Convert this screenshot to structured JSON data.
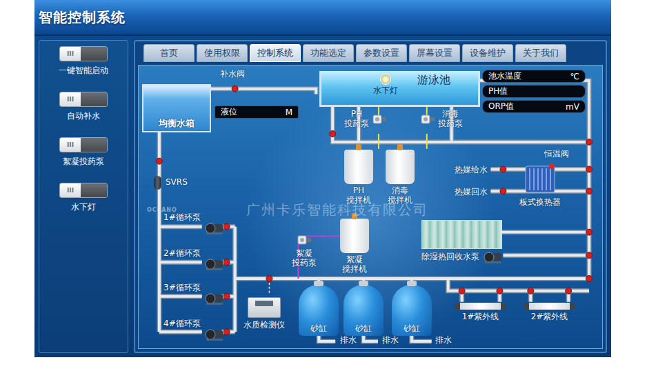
{
  "window": {
    "title": "智能控制系统"
  },
  "sidebar": {
    "switches": [
      {
        "label": "一键智能启动",
        "toggle": "III",
        "on": false
      },
      {
        "label": "自动补水",
        "toggle": "III",
        "on": false
      },
      {
        "label": "絮凝投药泵",
        "toggle": "III",
        "on": false
      },
      {
        "label": "水下灯",
        "toggle": "III",
        "on": false
      }
    ]
  },
  "tabs": [
    {
      "label": "首页",
      "selected": false
    },
    {
      "label": "使用权限",
      "selected": false
    },
    {
      "label": "控制系统",
      "selected": true
    },
    {
      "label": "功能选定",
      "selected": false
    },
    {
      "label": "参数设置",
      "selected": false
    },
    {
      "label": "屏幕设置",
      "selected": false
    },
    {
      "label": "设备维护",
      "selected": false
    },
    {
      "label": "关于我们",
      "selected": false
    }
  ],
  "readings": [
    {
      "label": "池水温度",
      "unit": "℃"
    },
    {
      "label": "PH值",
      "unit": ""
    },
    {
      "label": "ORP值",
      "unit": "mV"
    }
  ],
  "level": {
    "label": "液位",
    "unit": "M"
  },
  "watermark": {
    "logo": "OCEANO",
    "company": "广州卡乐智能科技有限公司"
  },
  "nodes": [
    {
      "kind": "label",
      "lines": [
        "补水阀"
      ]
    },
    {
      "kind": "tank",
      "lines": [
        "均衡水箱"
      ]
    },
    {
      "kind": "pool",
      "lines": [
        "游泳池"
      ]
    },
    {
      "kind": "light",
      "lines": [
        "水下灯"
      ]
    },
    {
      "kind": "svrs",
      "lines": [
        "SVRS"
      ]
    },
    {
      "kind": "pump",
      "lines": [
        "1#循环泵"
      ]
    },
    {
      "kind": "pump",
      "lines": [
        "2#循环泵"
      ]
    },
    {
      "kind": "pump",
      "lines": [
        "3#循环泵"
      ]
    },
    {
      "kind": "pump",
      "lines": [
        "4#循环泵"
      ]
    },
    {
      "kind": "doser",
      "lines": [
        "PH",
        "投药泵"
      ]
    },
    {
      "kind": "doser",
      "lines": [
        "消毒",
        "投药泵"
      ]
    },
    {
      "kind": "mixer",
      "lines": [
        "PH",
        "搅拌机"
      ]
    },
    {
      "kind": "mixer",
      "lines": [
        "消毒",
        "搅拌机"
      ]
    },
    {
      "kind": "doser",
      "lines": [
        "絮凝",
        "投药泵"
      ]
    },
    {
      "kind": "mixer",
      "lines": [
        "絮凝",
        "搅拌机"
      ]
    },
    {
      "kind": "label",
      "lines": [
        "热媒给水"
      ]
    },
    {
      "kind": "label",
      "lines": [
        "热媒回水"
      ]
    },
    {
      "kind": "label",
      "lines": [
        "恒温阀"
      ]
    },
    {
      "kind": "exchanger",
      "lines": [
        "板式换热器"
      ]
    },
    {
      "kind": "dehumidifier",
      "lines": [
        "除湿热回收水泵"
      ]
    },
    {
      "kind": "detector",
      "lines": [
        "水质检测仪"
      ]
    },
    {
      "kind": "sand",
      "lines": [
        "砂缸"
      ]
    },
    {
      "kind": "sand",
      "lines": [
        "砂缸"
      ]
    },
    {
      "kind": "sand",
      "lines": [
        "砂缸"
      ]
    },
    {
      "kind": "label",
      "lines": [
        "排水"
      ]
    },
    {
      "kind": "label",
      "lines": [
        "排水"
      ]
    },
    {
      "kind": "label",
      "lines": [
        "排水"
      ]
    },
    {
      "kind": "uv",
      "lines": [
        "1#紫外线"
      ]
    },
    {
      "kind": "uv",
      "lines": [
        "2#紫外线"
      ]
    }
  ]
}
